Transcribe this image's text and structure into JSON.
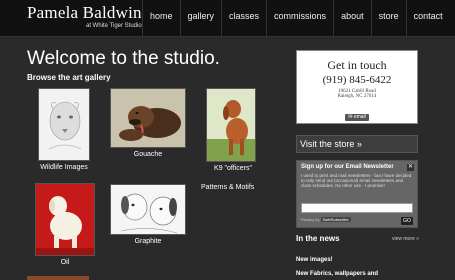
{
  "header": {
    "logo_name": "Pamela Baldwin",
    "logo_sub": "at White Tiger Studio",
    "nav": [
      "home",
      "gallery",
      "classes",
      "commissions",
      "about",
      "store",
      "contact"
    ]
  },
  "main": {
    "title": "Welcome to the studio.",
    "subtitle": "Browse the art gallery",
    "gallery": [
      {
        "caption": "Wildlife Images"
      },
      {
        "caption": "Gouache"
      },
      {
        "caption": "K9 \"officers\""
      },
      {
        "caption": "Oil"
      },
      {
        "caption": "Graphite"
      }
    ],
    "patterns": "Patterns & Motifs"
  },
  "sidebar": {
    "contact": {
      "heading": "Get in touch",
      "phone": "(919) 845-6422",
      "address1": "10621 Cahill Road",
      "address2": "Raleigh, NC 27614",
      "email_label": "email"
    },
    "store_label": "Visit the store »",
    "newsletter": {
      "title": "Sign up for our Email Newsletter",
      "close": "✕",
      "text": "I used to print and mail newsletters - but I have decided to only send out (occasional) email newsletters and class schedules. No other use - I promise!",
      "badge_prefix": "Privacy by",
      "badge": "SafeSubscribe",
      "go": "GO"
    },
    "news": {
      "heading": "In the news",
      "view_more": "view more »",
      "items": [
        "New images!",
        "New Fabrics, wallpapers and"
      ]
    }
  },
  "colors": {
    "background": "#2a2a2a",
    "header": "#111111"
  }
}
